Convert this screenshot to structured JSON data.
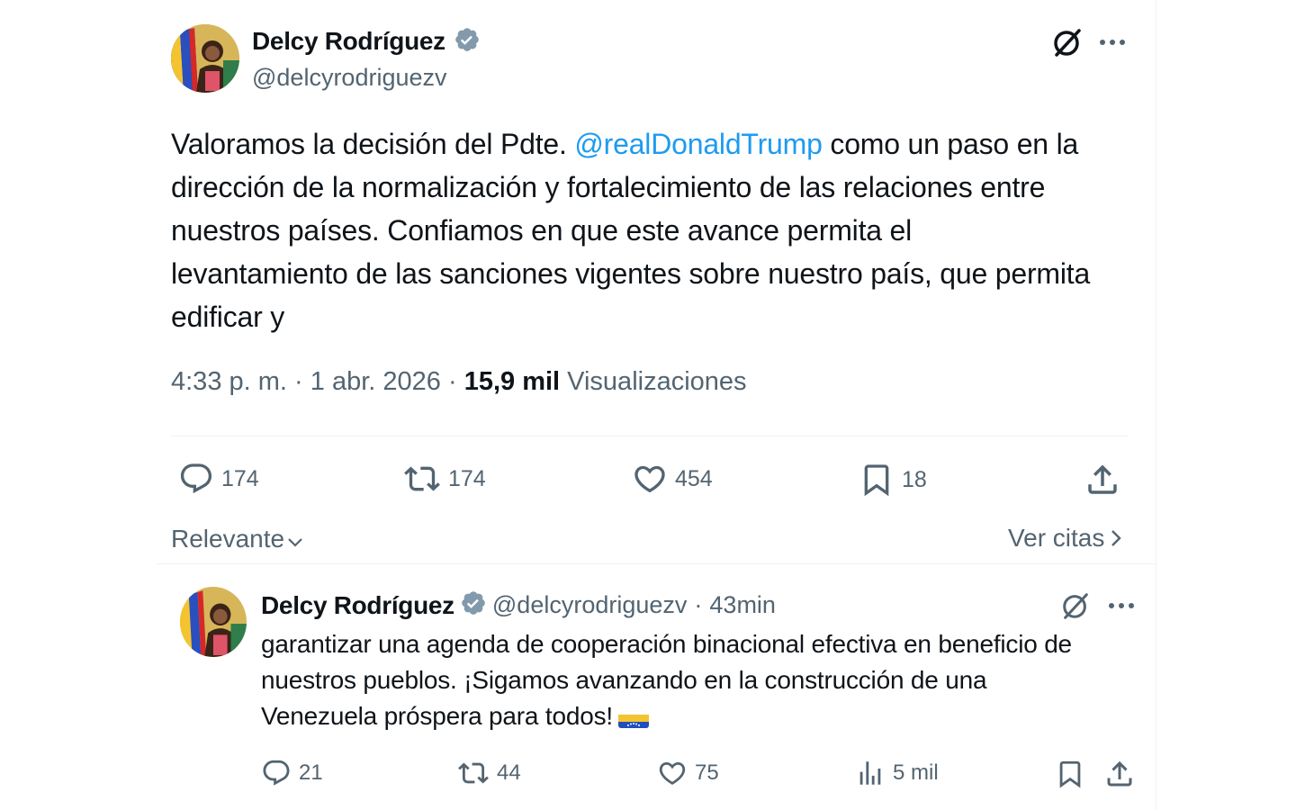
{
  "main_tweet": {
    "author_name": "Delcy Rodríguez",
    "author_handle": "@delcyrodriguezv",
    "text_lines": [
      {
        "before": "Valoramos la decisión del Pdte. ",
        "mention": "@realDonaldTrump",
        "after": " como un paso en la"
      },
      {
        "text": "dirección de la normalización y fortalecimiento de las relaciones entre"
      },
      {
        "text": "nuestros países. Confiamos en que este avance permita el"
      },
      {
        "text": "levantamiento de las sanciones vigentes sobre nuestro país, que permita"
      },
      {
        "text": "edificar y"
      }
    ],
    "time": "4:33 p. m.",
    "date": "1 abr. 2026",
    "separator": "·",
    "views_count": "15,9 mil",
    "views_label": "Visualizaciones",
    "replies": "174",
    "reposts": "174",
    "likes": "454",
    "bookmarks": "18"
  },
  "sort": {
    "label": "Relevante",
    "quotes_link": "Ver citas"
  },
  "reply_tweet": {
    "author_name": "Delcy Rodríguez",
    "author_handle": "@delcyrodriguezv",
    "dot": "·",
    "age": "43min",
    "text_lines": [
      "garantizar una agenda de cooperación binacional efectiva en beneficio de",
      "nuestros pueblos. ¡Sigamos avanzando en la construcción de una",
      "Venezuela próspera para todos!"
    ],
    "replies": "21",
    "reposts": "44",
    "likes": "75",
    "views": "5 mil"
  },
  "icons": {
    "verified": "verified-badge-icon",
    "grok": "grok-icon",
    "more": "more-icon",
    "reply": "reply-icon",
    "repost": "repost-icon",
    "like": "heart-icon",
    "bookmark": "bookmark-icon",
    "share": "share-icon",
    "views": "analytics-icon",
    "flag": "venezuela-flag-emoji"
  },
  "colors": {
    "text": "#0f1419",
    "secondary": "#536471",
    "link": "#1d9bf0",
    "verified": "#829aab",
    "divider": "#eff3f4"
  }
}
